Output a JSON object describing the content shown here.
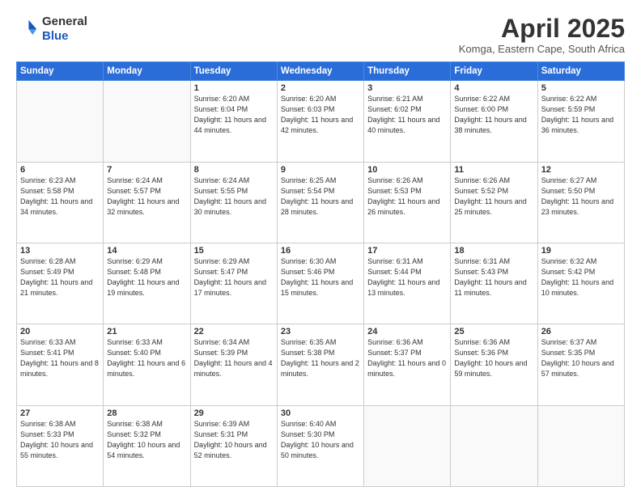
{
  "header": {
    "logo_general": "General",
    "logo_blue": "Blue",
    "month_year": "April 2025",
    "location": "Komga, Eastern Cape, South Africa"
  },
  "weekdays": [
    "Sunday",
    "Monday",
    "Tuesday",
    "Wednesday",
    "Thursday",
    "Friday",
    "Saturday"
  ],
  "weeks": [
    [
      {
        "day": "",
        "info": ""
      },
      {
        "day": "",
        "info": ""
      },
      {
        "day": "1",
        "info": "Sunrise: 6:20 AM\nSunset: 6:04 PM\nDaylight: 11 hours and 44 minutes."
      },
      {
        "day": "2",
        "info": "Sunrise: 6:20 AM\nSunset: 6:03 PM\nDaylight: 11 hours and 42 minutes."
      },
      {
        "day": "3",
        "info": "Sunrise: 6:21 AM\nSunset: 6:02 PM\nDaylight: 11 hours and 40 minutes."
      },
      {
        "day": "4",
        "info": "Sunrise: 6:22 AM\nSunset: 6:00 PM\nDaylight: 11 hours and 38 minutes."
      },
      {
        "day": "5",
        "info": "Sunrise: 6:22 AM\nSunset: 5:59 PM\nDaylight: 11 hours and 36 minutes."
      }
    ],
    [
      {
        "day": "6",
        "info": "Sunrise: 6:23 AM\nSunset: 5:58 PM\nDaylight: 11 hours and 34 minutes."
      },
      {
        "day": "7",
        "info": "Sunrise: 6:24 AM\nSunset: 5:57 PM\nDaylight: 11 hours and 32 minutes."
      },
      {
        "day": "8",
        "info": "Sunrise: 6:24 AM\nSunset: 5:55 PM\nDaylight: 11 hours and 30 minutes."
      },
      {
        "day": "9",
        "info": "Sunrise: 6:25 AM\nSunset: 5:54 PM\nDaylight: 11 hours and 28 minutes."
      },
      {
        "day": "10",
        "info": "Sunrise: 6:26 AM\nSunset: 5:53 PM\nDaylight: 11 hours and 26 minutes."
      },
      {
        "day": "11",
        "info": "Sunrise: 6:26 AM\nSunset: 5:52 PM\nDaylight: 11 hours and 25 minutes."
      },
      {
        "day": "12",
        "info": "Sunrise: 6:27 AM\nSunset: 5:50 PM\nDaylight: 11 hours and 23 minutes."
      }
    ],
    [
      {
        "day": "13",
        "info": "Sunrise: 6:28 AM\nSunset: 5:49 PM\nDaylight: 11 hours and 21 minutes."
      },
      {
        "day": "14",
        "info": "Sunrise: 6:29 AM\nSunset: 5:48 PM\nDaylight: 11 hours and 19 minutes."
      },
      {
        "day": "15",
        "info": "Sunrise: 6:29 AM\nSunset: 5:47 PM\nDaylight: 11 hours and 17 minutes."
      },
      {
        "day": "16",
        "info": "Sunrise: 6:30 AM\nSunset: 5:46 PM\nDaylight: 11 hours and 15 minutes."
      },
      {
        "day": "17",
        "info": "Sunrise: 6:31 AM\nSunset: 5:44 PM\nDaylight: 11 hours and 13 minutes."
      },
      {
        "day": "18",
        "info": "Sunrise: 6:31 AM\nSunset: 5:43 PM\nDaylight: 11 hours and 11 minutes."
      },
      {
        "day": "19",
        "info": "Sunrise: 6:32 AM\nSunset: 5:42 PM\nDaylight: 11 hours and 10 minutes."
      }
    ],
    [
      {
        "day": "20",
        "info": "Sunrise: 6:33 AM\nSunset: 5:41 PM\nDaylight: 11 hours and 8 minutes."
      },
      {
        "day": "21",
        "info": "Sunrise: 6:33 AM\nSunset: 5:40 PM\nDaylight: 11 hours and 6 minutes."
      },
      {
        "day": "22",
        "info": "Sunrise: 6:34 AM\nSunset: 5:39 PM\nDaylight: 11 hours and 4 minutes."
      },
      {
        "day": "23",
        "info": "Sunrise: 6:35 AM\nSunset: 5:38 PM\nDaylight: 11 hours and 2 minutes."
      },
      {
        "day": "24",
        "info": "Sunrise: 6:36 AM\nSunset: 5:37 PM\nDaylight: 11 hours and 0 minutes."
      },
      {
        "day": "25",
        "info": "Sunrise: 6:36 AM\nSunset: 5:36 PM\nDaylight: 10 hours and 59 minutes."
      },
      {
        "day": "26",
        "info": "Sunrise: 6:37 AM\nSunset: 5:35 PM\nDaylight: 10 hours and 57 minutes."
      }
    ],
    [
      {
        "day": "27",
        "info": "Sunrise: 6:38 AM\nSunset: 5:33 PM\nDaylight: 10 hours and 55 minutes."
      },
      {
        "day": "28",
        "info": "Sunrise: 6:38 AM\nSunset: 5:32 PM\nDaylight: 10 hours and 54 minutes."
      },
      {
        "day": "29",
        "info": "Sunrise: 6:39 AM\nSunset: 5:31 PM\nDaylight: 10 hours and 52 minutes."
      },
      {
        "day": "30",
        "info": "Sunrise: 6:40 AM\nSunset: 5:30 PM\nDaylight: 10 hours and 50 minutes."
      },
      {
        "day": "",
        "info": ""
      },
      {
        "day": "",
        "info": ""
      },
      {
        "day": "",
        "info": ""
      }
    ]
  ]
}
